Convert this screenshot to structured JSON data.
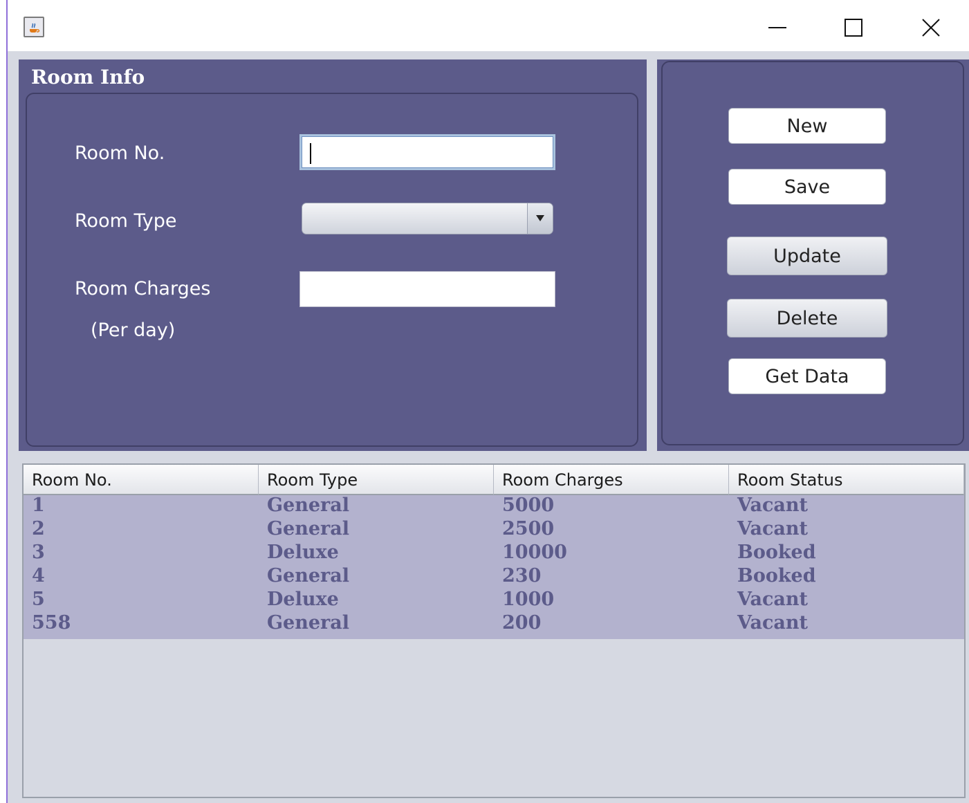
{
  "window": {
    "app_icon": "java-coffee-cup-icon",
    "controls": [
      "minimize-icon",
      "maximize-icon",
      "close-icon"
    ]
  },
  "room_info": {
    "title": "Room Info",
    "room_no_label": "Room No.",
    "room_no_value": "",
    "room_type_label": "Room Type",
    "room_type_selected": "",
    "room_charges_label": "Room Charges",
    "room_charges_sublabel": "(Per day)",
    "room_charges_value": ""
  },
  "actions": {
    "new": "New",
    "save": "Save",
    "update": "Update",
    "delete": "Delete",
    "get_data": "Get Data"
  },
  "table": {
    "columns": [
      "Room No.",
      "Room Type",
      "Room Charges",
      "Room Status"
    ],
    "rows": [
      [
        "1",
        "General",
        "5000",
        "Vacant"
      ],
      [
        "2",
        "General",
        "2500",
        "Vacant"
      ],
      [
        "3",
        "Deluxe",
        "10000",
        "Booked"
      ],
      [
        "4",
        "General",
        "230",
        "Booked"
      ],
      [
        "5",
        "Deluxe",
        "1000",
        "Vacant"
      ],
      [
        "558",
        "General",
        "200",
        "Vacant"
      ]
    ]
  },
  "colors": {
    "panel": "#5c5b8a",
    "background": "#d6d9e2",
    "row_selection": "#b3b2ce",
    "row_text": "#5c5b8a"
  }
}
